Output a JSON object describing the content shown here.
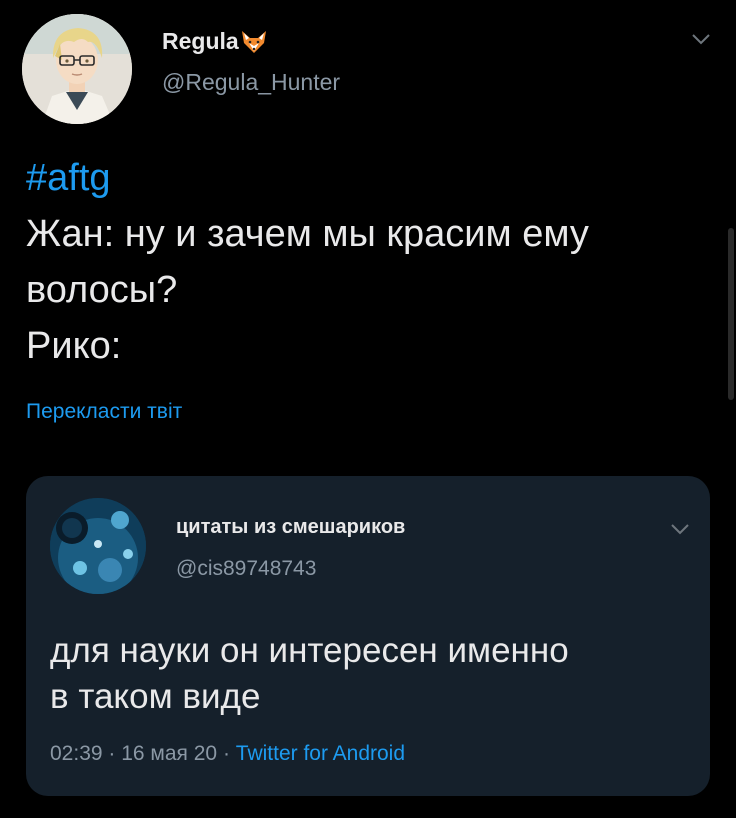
{
  "tweet": {
    "display_name": "Regula",
    "handle": "@Regula_Hunter",
    "hashtag": "#aftg",
    "lines": [
      "Жан: ну и зачем мы красим ему",
      "волосы?",
      "Рико:"
    ],
    "translate_label": "Перекласти твіт"
  },
  "quote": {
    "display_name": "цитаты из смешариков",
    "handle": "@cis89748743",
    "lines": [
      "для науки он интересен именно",
      "в таком виде"
    ],
    "time": "02:39",
    "sep1": " · ",
    "date": "16 мая 20",
    "sep2": " · ",
    "source": "Twitter for Android"
  },
  "icons": {
    "fox": "fox-emoji-icon",
    "chevron": "chevron-down-icon"
  },
  "colors": {
    "background": "#000000",
    "link": "#1d9bf0",
    "secondary_text": "#8b98a5",
    "quote_card": "#15202b"
  }
}
